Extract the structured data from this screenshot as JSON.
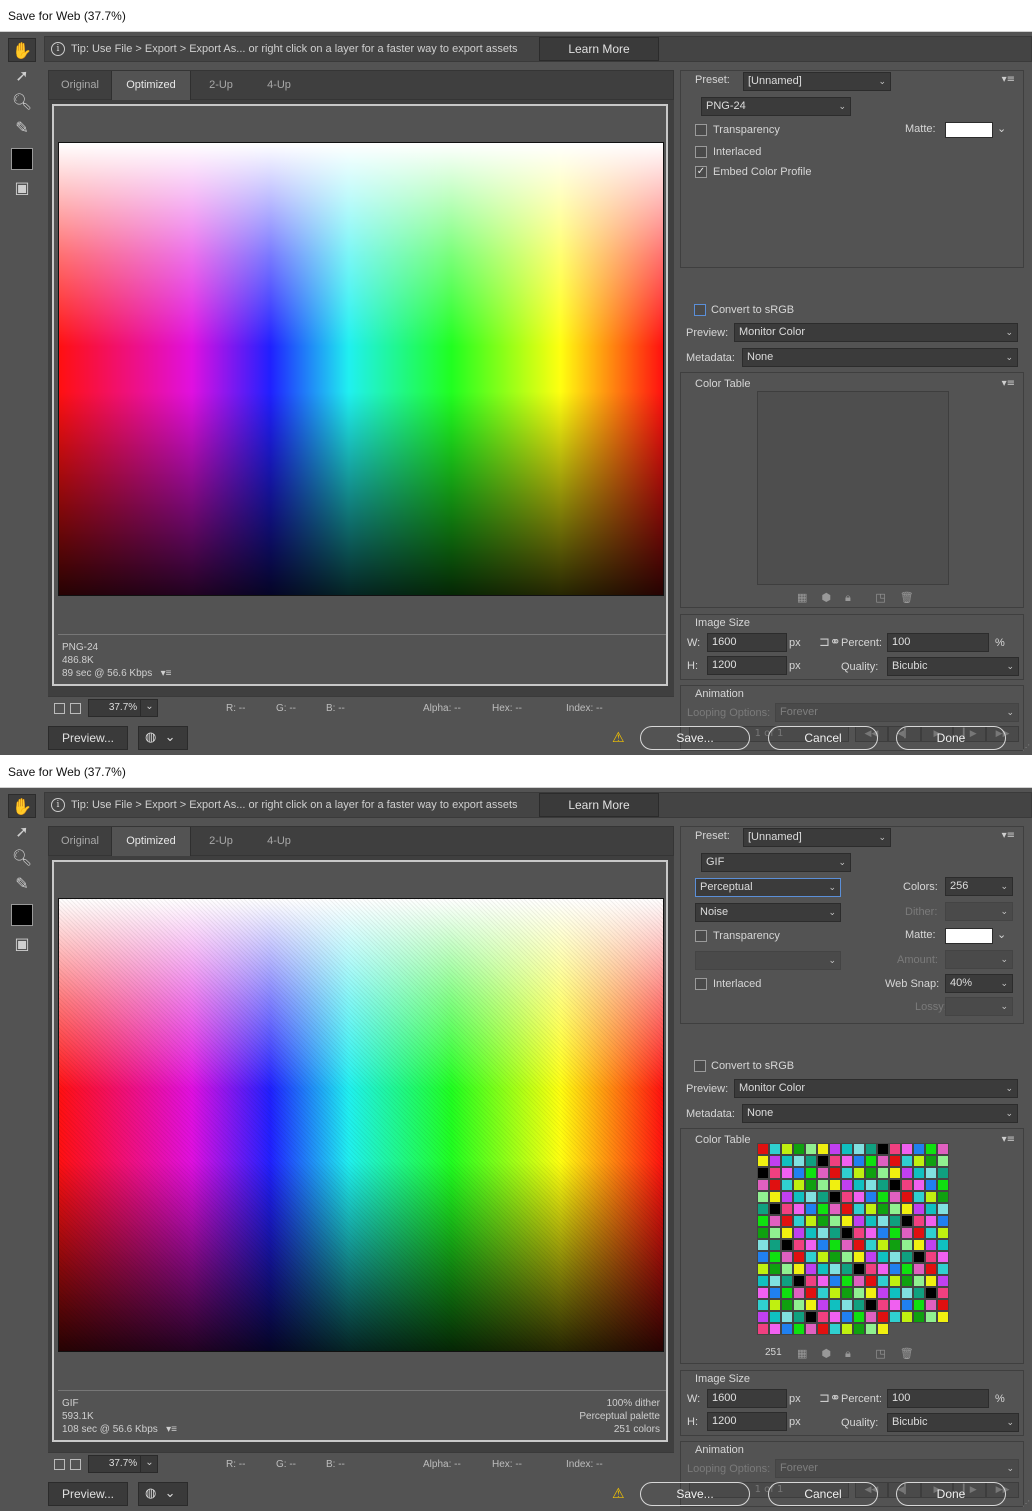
{
  "windows": [
    {
      "title": "Save for Web (37.7%)",
      "tip": {
        "text": "Tip: Use File > Export > Export As...  or right click on a layer for a faster way to export assets",
        "button": "Learn More"
      },
      "tools": [
        "hand-icon",
        "slice-select-icon",
        "zoom-icon",
        "eyedropper-icon"
      ],
      "tabs": [
        "Original",
        "Optimized",
        "2-Up",
        "4-Up"
      ],
      "active_tab": "Optimized",
      "info": {
        "format": "PNG-24",
        "size": "486.8K",
        "time": "89 sec @ 56.6 Kbps",
        "menu": "▾≡"
      },
      "info_right": null,
      "status": {
        "zoom": "37.7%",
        "r": "R: --",
        "g": "G: --",
        "b": "B: --",
        "alpha": "Alpha: --",
        "hex": "Hex: --",
        "index": "Index: --"
      },
      "buttons": {
        "preview": "Preview...",
        "save": "Save...",
        "cancel": "Cancel",
        "done": "Done"
      },
      "panel": {
        "preset_label": "Preset:",
        "preset_value": "[Unnamed]",
        "format": "PNG-24",
        "rows_png": [
          {
            "label": "Transparency",
            "checked": false
          },
          {
            "label": "Interlaced",
            "checked": false
          },
          {
            "label": "Embed Color Profile",
            "checked": true
          }
        ],
        "matte_label": "Matte:",
        "convert_label": "Convert to sRGB",
        "preview_label": "Preview:",
        "preview_value": "Monitor Color",
        "metadata_label": "Metadata:",
        "metadata_value": "None",
        "color_table_label": "Color Table",
        "color_count": "",
        "image_size_label": "Image Size",
        "w_label": "W:",
        "w_value": "1600",
        "h_label": "H:",
        "h_value": "1200",
        "px": "px",
        "percent_label": "Percent:",
        "percent_value": "100",
        "percent_unit": "%",
        "quality_label": "Quality:",
        "quality_value": "Bicubic",
        "animation_label": "Animation",
        "looping_label": "Looping Options:",
        "looping_value": "Forever",
        "frame_label": "1 of 1"
      }
    },
    {
      "title": "Save for Web (37.7%)",
      "tip": {
        "text": "Tip: Use File > Export > Export As...  or right click on a layer for a faster way to export assets",
        "button": "Learn More"
      },
      "tools": [
        "hand-icon",
        "slice-select-icon",
        "zoom-icon",
        "eyedropper-icon"
      ],
      "tabs": [
        "Original",
        "Optimized",
        "2-Up",
        "4-Up"
      ],
      "active_tab": "Optimized",
      "info": {
        "format": "GIF",
        "size": "593.1K",
        "time": "108 sec @ 56.6 Kbps",
        "menu": "▾≡"
      },
      "info_right": {
        "dither": "100% dither",
        "palette": "Perceptual palette",
        "colors": "251 colors"
      },
      "status": {
        "zoom": "37.7%",
        "r": "R: --",
        "g": "G: --",
        "b": "B: --",
        "alpha": "Alpha: --",
        "hex": "Hex: --",
        "index": "Index: --"
      },
      "buttons": {
        "preview": "Preview...",
        "save": "Save...",
        "cancel": "Cancel",
        "done": "Done"
      },
      "panel": {
        "preset_label": "Preset:",
        "preset_value": "[Unnamed]",
        "format": "GIF",
        "reduction": "Perceptual",
        "dither_algo": "Noise",
        "colors_label": "Colors:",
        "colors_value": "256",
        "dither_label": "Dither:",
        "transparency_label": "Transparency",
        "matte_label": "Matte:",
        "amount_label": "Amount:",
        "interlaced_label": "Interlaced",
        "websnap_label": "Web Snap:",
        "websnap_value": "40%",
        "lossy_label": "Lossy:",
        "convert_label": "Convert to sRGB",
        "preview_label": "Preview:",
        "preview_value": "Monitor Color",
        "metadata_label": "Metadata:",
        "metadata_value": "None",
        "color_table_label": "Color Table",
        "color_count": "251",
        "image_size_label": "Image Size",
        "w_label": "W:",
        "w_value": "1600",
        "h_label": "H:",
        "h_value": "1200",
        "px": "px",
        "percent_label": "Percent:",
        "percent_value": "100",
        "percent_unit": "%",
        "quality_label": "Quality:",
        "quality_value": "Bicubic",
        "animation_label": "Animation",
        "looping_label": "Looping Options:",
        "looping_value": "Forever",
        "frame_label": "1 of 1"
      }
    }
  ],
  "palette_colors": [
    "#e01010",
    "#10c0c0",
    "#10e010",
    "#f0f010",
    "#f060f0",
    "#10a010",
    "#000000",
    "#30d0d0",
    "#80e0e0",
    "#e060c0",
    "#c040f0",
    "#2080f0",
    "#90f090",
    "#f04080",
    "#c0f010",
    "#10a080"
  ]
}
